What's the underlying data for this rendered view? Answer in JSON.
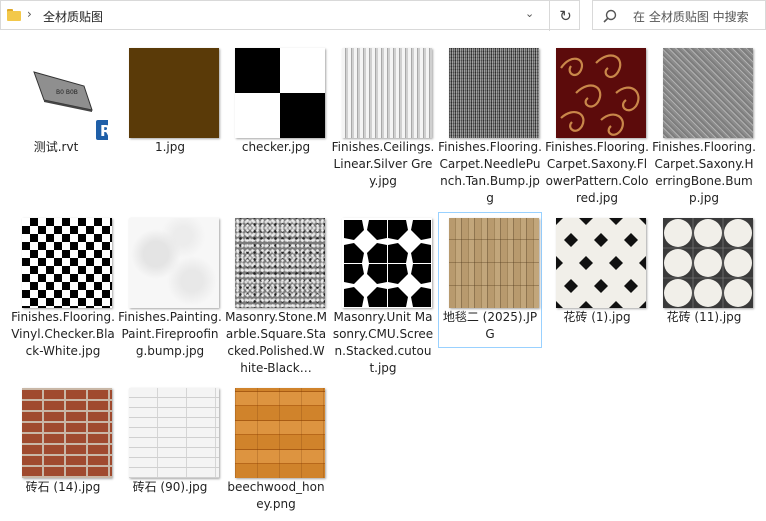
{
  "address_bar": {
    "path": "全材质贴图",
    "refresh_icon": "refresh-icon",
    "folder_icon": "folder-icon"
  },
  "search": {
    "placeholder": "在 全材质贴图 中搜索"
  },
  "files": [
    {
      "name": "测试.rvt",
      "thumb": "rvt-preview"
    },
    {
      "name": "1.jpg",
      "thumb": "brown"
    },
    {
      "name": "checker.jpg",
      "thumb": "checker"
    },
    {
      "name": "Finishes.Ceilings.Linear.Silver Grey.jpg",
      "thumb": "ceiling"
    },
    {
      "name": "Finishes.Flooring.Carpet.NeedlePunch.Tan.Bump.jpg",
      "thumb": "needle"
    },
    {
      "name": "Finishes.Flooring.Carpet.Saxony.FlowerPattern.Colored.jpg",
      "thumb": "flower"
    },
    {
      "name": "Finishes.Flooring.Carpet.Saxony.HerringBone.Bump.jpg",
      "thumb": "herring"
    },
    {
      "name": "Finishes.Flooring.Vinyl.Checker.Black-White.jpg",
      "thumb": "vinyl"
    },
    {
      "name": "Finishes.Painting.Paint.Fireproofing.bump.jpg",
      "thumb": "paint"
    },
    {
      "name": "Masonry.Stone.Marble.Square.Stacked.Polished.White-Black…",
      "thumb": "marble"
    },
    {
      "name": "Masonry.Unit Masonry.CMU.Screen.Stacked.cutout.jpg",
      "thumb": "cmu"
    },
    {
      "name": "地毯二 (2025).JPG",
      "thumb": "bamboo"
    },
    {
      "name": "花砖 (1).jpg",
      "thumb": "tile1"
    },
    {
      "name": "花砖 (11).jpg",
      "thumb": "tile2"
    },
    {
      "name": "砖石 (14).jpg",
      "thumb": "brick"
    },
    {
      "name": "砖石 (90).jpg",
      "thumb": "whitebrick"
    },
    {
      "name": "beechwood_honey.png",
      "thumb": "beech"
    }
  ],
  "rvt_preview_text": "B0 B0B",
  "rvt_badge": "R",
  "colors": {
    "selection_border": "#99d1ff",
    "revit_blue": "#1f5fa8",
    "folder_yellow": "#f3c84a"
  }
}
